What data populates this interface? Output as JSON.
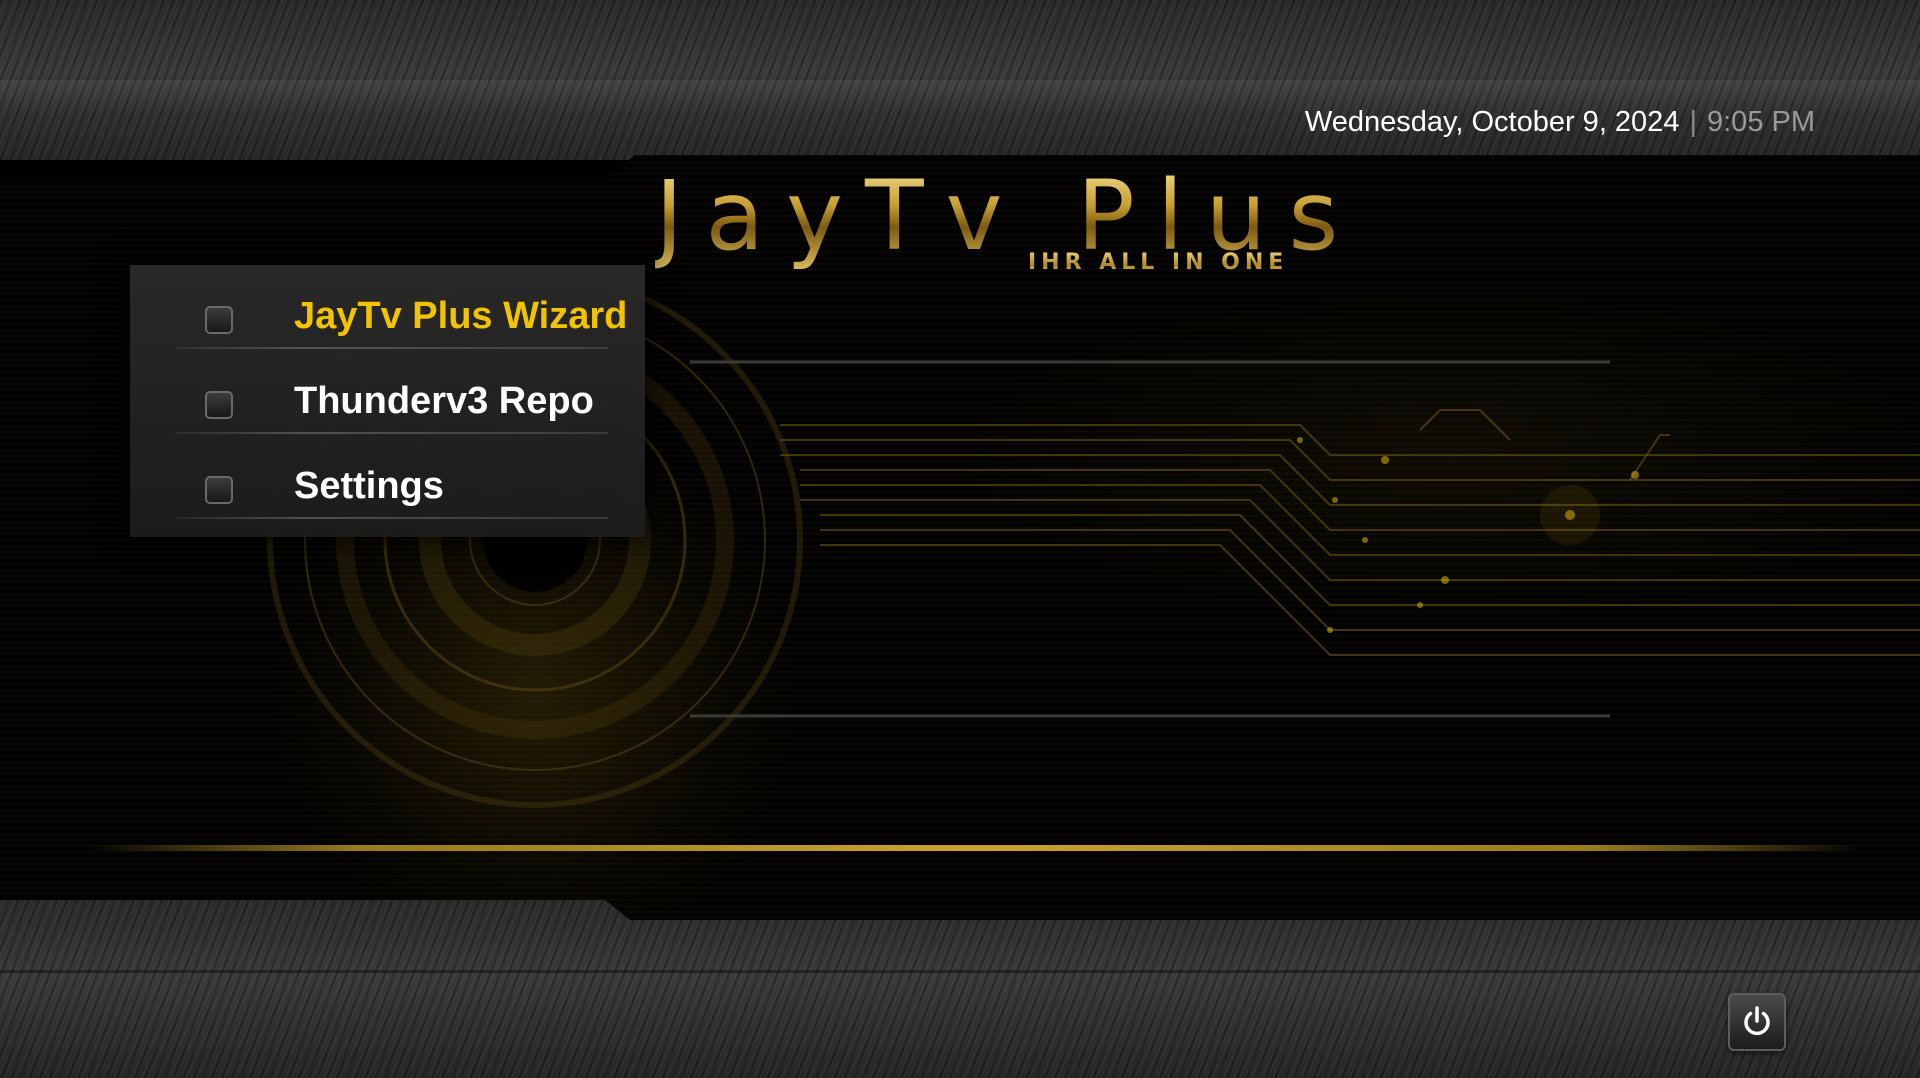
{
  "header": {
    "date": "Wednesday, October 9, 2024",
    "separator": "|",
    "time": "9:05 PM"
  },
  "logo": {
    "title": "JayTv Plus",
    "subtitle": "IHR ALL IN ONE"
  },
  "menu": {
    "items": [
      {
        "label": "JayTv Plus Wizard",
        "selected": true
      },
      {
        "label": "Thunderv3 Repo",
        "selected": false
      },
      {
        "label": "Settings",
        "selected": false
      }
    ]
  },
  "footer": {
    "power_icon": "power-icon"
  },
  "colors": {
    "accent_gold": "#f2c300",
    "text_white": "#ffffff",
    "time_gray": "#9a9a9a"
  }
}
